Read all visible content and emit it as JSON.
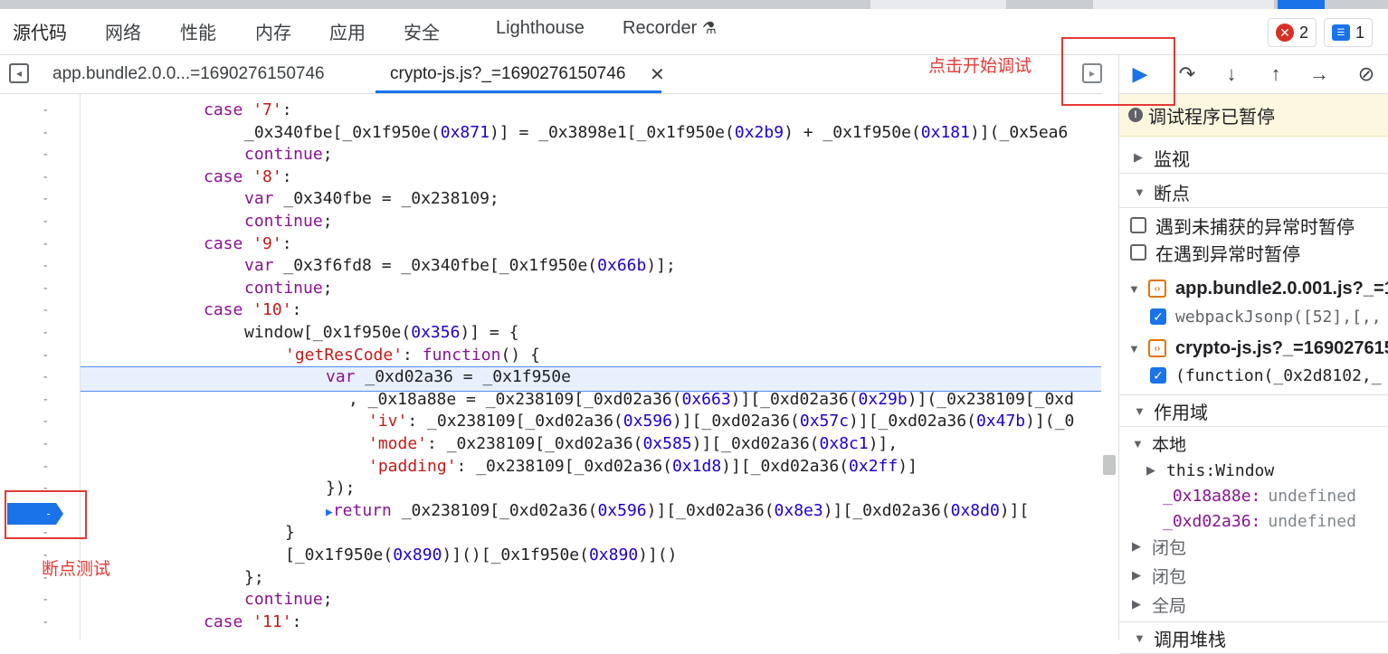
{
  "panels": [
    "源代码",
    "网络",
    "性能",
    "内存",
    "应用",
    "安全",
    "Lighthouse",
    "Recorder"
  ],
  "status": {
    "errors": "2",
    "messages": "1"
  },
  "file_tabs": [
    "app.bundle2.0.0...=1690276150746",
    "crypto-js.js?_=1690276150746"
  ],
  "code": [
    [
      {
        "t": "case ",
        "c": "kw"
      },
      {
        "t": "'7'",
        "c": "str"
      },
      {
        "t": ":",
        "c": ""
      }
    ],
    [
      {
        "t": "_0x340fbe[_0x1f950e(",
        "c": ""
      },
      {
        "t": "0x871",
        "c": "num"
      },
      {
        "t": ")] = _0x3898e1[_0x1f950e(",
        "c": ""
      },
      {
        "t": "0x2b9",
        "c": "num"
      },
      {
        "t": ") + _0x1f950e(",
        "c": ""
      },
      {
        "t": "0x181",
        "c": "num"
      },
      {
        "t": ")](_0x5ea6",
        "c": ""
      }
    ],
    [
      {
        "t": "continue",
        "c": "kw"
      },
      {
        "t": ";",
        "c": ""
      }
    ],
    [
      {
        "t": "case ",
        "c": "kw"
      },
      {
        "t": "'8'",
        "c": "str"
      },
      {
        "t": ":",
        "c": ""
      }
    ],
    [
      {
        "t": "var ",
        "c": "kw"
      },
      {
        "t": "_0x340fbe = _0x238109;",
        "c": ""
      }
    ],
    [
      {
        "t": "continue",
        "c": "kw"
      },
      {
        "t": ";",
        "c": ""
      }
    ],
    [
      {
        "t": "case ",
        "c": "kw"
      },
      {
        "t": "'9'",
        "c": "str"
      },
      {
        "t": ":",
        "c": ""
      }
    ],
    [
      {
        "t": "var ",
        "c": "kw"
      },
      {
        "t": "_0x3f6fd8 = _0x340fbe[_0x1f950e(",
        "c": ""
      },
      {
        "t": "0x66b",
        "c": "num"
      },
      {
        "t": ")];",
        "c": ""
      }
    ],
    [
      {
        "t": "continue",
        "c": "kw"
      },
      {
        "t": ";",
        "c": ""
      }
    ],
    [
      {
        "t": "case ",
        "c": "kw"
      },
      {
        "t": "'10'",
        "c": "str"
      },
      {
        "t": ":",
        "c": ""
      }
    ],
    [
      {
        "t": "window[_0x1f950e(",
        "c": ""
      },
      {
        "t": "0x356",
        "c": "num"
      },
      {
        "t": ")] = {",
        "c": ""
      }
    ],
    [
      {
        "t": "'getResCode'",
        "c": "str"
      },
      {
        "t": ": ",
        "c": ""
      },
      {
        "t": "function",
        "c": "kw"
      },
      {
        "t": "() {",
        "c": ""
      }
    ],
    [
      {
        "t": "var ",
        "c": "kw"
      },
      {
        "t": "_0xd02a36 = _0x1f950e",
        "c": ""
      }
    ],
    [
      {
        "t": ", _0x18a88e = _0x238109[_0xd02a36(",
        "c": ""
      },
      {
        "t": "0x663",
        "c": "num"
      },
      {
        "t": ")][_0xd02a36(",
        "c": ""
      },
      {
        "t": "0x29b",
        "c": "num"
      },
      {
        "t": ")](_0x238109[_0xd",
        "c": ""
      }
    ],
    [
      {
        "t": "'iv'",
        "c": "str"
      },
      {
        "t": ": _0x238109[_0xd02a36(",
        "c": ""
      },
      {
        "t": "0x596",
        "c": "num"
      },
      {
        "t": ")][_0xd02a36(",
        "c": ""
      },
      {
        "t": "0x57c",
        "c": "num"
      },
      {
        "t": ")][_0xd02a36(",
        "c": ""
      },
      {
        "t": "0x47b",
        "c": "num"
      },
      {
        "t": ")](_0",
        "c": ""
      }
    ],
    [
      {
        "t": "'mode'",
        "c": "str"
      },
      {
        "t": ": _0x238109[_0xd02a36(",
        "c": ""
      },
      {
        "t": "0x585",
        "c": "num"
      },
      {
        "t": ")][_0xd02a36(",
        "c": ""
      },
      {
        "t": "0x8c1",
        "c": "num"
      },
      {
        "t": ")],",
        "c": ""
      }
    ],
    [
      {
        "t": "'padding'",
        "c": "str"
      },
      {
        "t": ": _0x238109[_0xd02a36(",
        "c": ""
      },
      {
        "t": "0x1d8",
        "c": "num"
      },
      {
        "t": ")][_0xd02a36(",
        "c": ""
      },
      {
        "t": "0x2ff",
        "c": "num"
      },
      {
        "t": ")]",
        "c": ""
      }
    ],
    [
      {
        "t": "});",
        "c": ""
      }
    ],
    [
      {
        "t": "return",
        "c": "kw"
      },
      {
        "t": " _0x238109[",
        "c": ""
      },
      {
        "t": "_0xd02a36(",
        "c": ""
      },
      {
        "t": "0x596",
        "c": "num"
      },
      {
        "t": ")][",
        "c": ""
      },
      {
        "t": "_0xd02a36(",
        "c": ""
      },
      {
        "t": "0x8e3",
        "c": "num"
      },
      {
        "t": ")][",
        "c": ""
      },
      {
        "t": "_0xd02a36(",
        "c": ""
      },
      {
        "t": "0x8d0",
        "c": "num"
      },
      {
        "t": ")][",
        "c": ""
      }
    ],
    [
      {
        "t": "}",
        "c": ""
      }
    ],
    [
      {
        "t": "[_0x1f950e(",
        "c": ""
      },
      {
        "t": "0x890",
        "c": "num"
      },
      {
        "t": ")]()[_0x1f950e(",
        "c": ""
      },
      {
        "t": "0x890",
        "c": "num"
      },
      {
        "t": ")]()",
        "c": ""
      }
    ],
    [
      {
        "t": "};",
        "c": ""
      }
    ],
    [
      {
        "t": "continue",
        "c": "kw"
      },
      {
        "t": ";",
        "c": ""
      }
    ],
    [
      {
        "t": "case ",
        "c": "kw"
      },
      {
        "t": "'11'",
        "c": "str"
      },
      {
        "t": ":",
        "c": ""
      }
    ]
  ],
  "debugger": {
    "paused_text": "调试程序已暂停",
    "watch": "监视",
    "breakpoints": "断点",
    "pause_uncaught": "遇到未捕获的异常时暂停",
    "pause_caught": "在遇到异常时暂停",
    "bp_files": [
      {
        "file": "app.bundle2.0.001.js?_=16",
        "code": "webpackJsonp([52],[,,"
      },
      {
        "file": "crypto-js.js?_=169027615",
        "code": "(function(_0x2d8102,_"
      }
    ],
    "scope": "作用域",
    "local": "本地",
    "this_label": "this: ",
    "this_value": "Window",
    "vars": [
      {
        "name": "_0x18a88e:",
        "value": "undefined"
      },
      {
        "name": "_0xd02a36:",
        "value": "undefined"
      }
    ],
    "closure1": "闭包",
    "closure2": "闭包",
    "global": "全局",
    "callstack": "调用堆栈"
  },
  "annotations": {
    "start_debug": "点击开始调试",
    "bp_test": "断点测试"
  }
}
